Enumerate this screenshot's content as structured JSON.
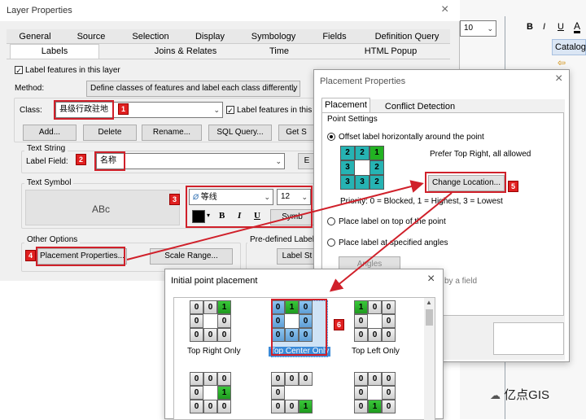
{
  "layer_props": {
    "title": "Layer Properties",
    "tabs_row1": [
      "General",
      "Source",
      "Selection",
      "Display",
      "Symbology",
      "Fields",
      "Definition Query"
    ],
    "tabs_row2": [
      "Labels",
      "Joins & Relates",
      "Time",
      "HTML Popup"
    ],
    "label_features": "Label features in this layer",
    "method_label": "Method:",
    "method_value": "Define classes of features and label each class differently",
    "class_label": "Class:",
    "class_value": "县级行政驻地",
    "class_label_features": "Label features in this cla",
    "buttons": [
      "Add...",
      "Delete",
      "Rename...",
      "SQL Query...",
      "Get S"
    ],
    "text_string_title": "Text String",
    "label_field_label": "Label Field:",
    "label_field_value": "名称",
    "label_field_btn": "E",
    "text_symbol_title": "Text Symbol",
    "preview_text": "ABc",
    "font_value": "等线",
    "font_size": "12",
    "fmt_buttons": [
      "B",
      "I",
      "U"
    ],
    "symbol_btn": "Symb",
    "other_options_title": "Other Options",
    "placement_btn": "Placement Properties...",
    "scale_range_btn": "Scale Range...",
    "predefined_title": "Pre-defined Label St",
    "label_styles_btn": "Label St"
  },
  "background_app": {
    "font_size": "10",
    "fmt": [
      "B",
      "I",
      "U",
      "A"
    ],
    "catalog_label": "Catalog"
  },
  "placement_dialog": {
    "title": "Placement Properties",
    "tabs": [
      "Placement",
      "Conflict Detection"
    ],
    "point_settings_title": "Point Settings",
    "radio_offset": "Offset label horizontally around the point",
    "prefer_text": "Prefer Top Right, all allowed",
    "grid_values": [
      [
        "2",
        "2",
        "1"
      ],
      [
        "3",
        "",
        "2"
      ],
      [
        "3",
        "3",
        "2"
      ]
    ],
    "change_location_btn": "Change Location...",
    "priority_text": "Priority:  0 = Blocked, 1 = Highest, 3 = Lowest",
    "radio_on_top": "Place label on top of the point",
    "radio_angles": "Place label at specified angles",
    "angles_btn": "Angles",
    "by_field_text": "by a field"
  },
  "initial_dialog": {
    "title": "Initial point placement",
    "items": [
      {
        "label": "Top Right Only",
        "grid": [
          [
            "0",
            "0",
            "1"
          ],
          [
            "0",
            "",
            "0"
          ],
          [
            "0",
            "0",
            "0"
          ]
        ],
        "green": [
          2
        ]
      },
      {
        "label": "Top Center Only",
        "grid": [
          [
            "0",
            "1",
            "0"
          ],
          [
            "0",
            "",
            "0"
          ],
          [
            "0",
            "0",
            "0"
          ]
        ],
        "green": [
          1
        ]
      },
      {
        "label": "Top Left Only",
        "grid": [
          [
            "1",
            "0",
            "0"
          ],
          [
            "0",
            "",
            "0"
          ],
          [
            "0",
            "0",
            "0"
          ]
        ],
        "green": [
          0
        ]
      },
      {
        "label": "",
        "grid": [
          [
            "0",
            "0",
            "0"
          ],
          [
            "0",
            "",
            "1"
          ],
          [
            "0",
            "0",
            "0"
          ]
        ],
        "green": [
          5
        ]
      },
      {
        "label": "",
        "grid": [
          [
            "0",
            "0",
            "0"
          ],
          [
            "0",
            "",
            ""
          ],
          [
            "0",
            "0",
            "1"
          ]
        ],
        "green": [
          8
        ]
      },
      {
        "label": "",
        "grid": [
          [
            "0",
            "0",
            "0"
          ],
          [
            "0",
            "",
            "0"
          ],
          [
            "0",
            "1",
            "0"
          ]
        ],
        "green": [
          7
        ]
      }
    ]
  },
  "badges": [
    "1",
    "2",
    "3",
    "4",
    "5",
    "6"
  ],
  "watermark": "亿点GIS",
  "colors": {
    "accent_red": "#d0202a",
    "selected_blue": "#3a8ad8",
    "green": "#22a022"
  }
}
